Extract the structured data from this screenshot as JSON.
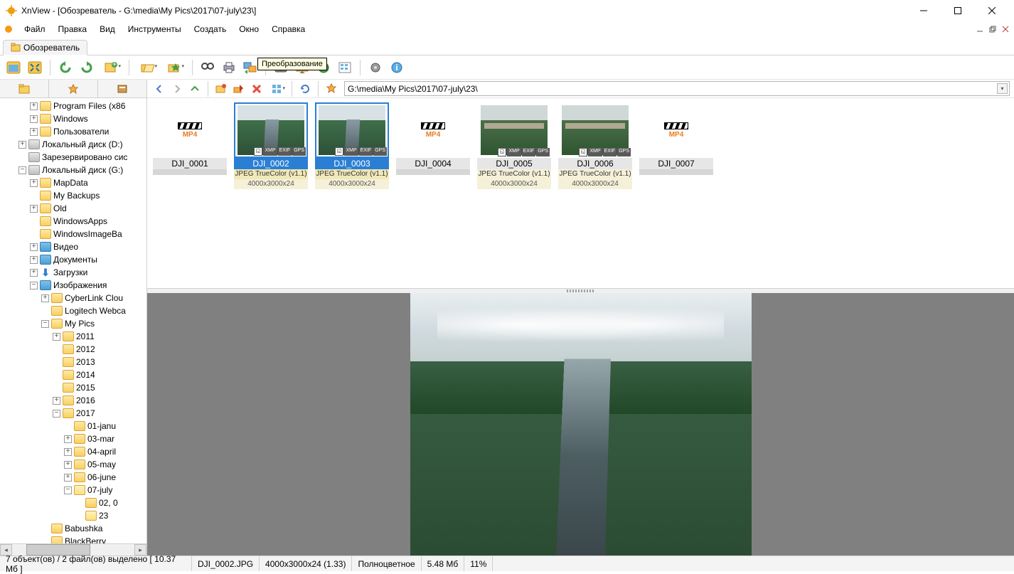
{
  "window": {
    "title": "XnView - [Обозреватель - G:\\media\\My Pics\\2017\\07-july\\23\\]"
  },
  "menu": {
    "file": "Файл",
    "edit": "Правка",
    "view": "Вид",
    "tools": "Инструменты",
    "create": "Создать",
    "window": "Окно",
    "help": "Справка"
  },
  "tab": {
    "label": "Обозреватель"
  },
  "tooltip": {
    "convert": "Преобразование"
  },
  "path": {
    "value": "G:\\media\\My Pics\\2017\\07-july\\23\\"
  },
  "tree": [
    {
      "indent": 42,
      "toggle": "+",
      "icon": "folder",
      "label": "Program Files (x86"
    },
    {
      "indent": 42,
      "toggle": "+",
      "icon": "folder",
      "label": "Windows"
    },
    {
      "indent": 42,
      "toggle": "+",
      "icon": "folder",
      "label": "Пользователи"
    },
    {
      "indent": 26,
      "toggle": "+",
      "icon": "drive",
      "label": "Локальный диск (D:)"
    },
    {
      "indent": 26,
      "toggle": "",
      "icon": "drive",
      "label": "Зарезервировано сис"
    },
    {
      "indent": 26,
      "toggle": "−",
      "icon": "drive",
      "label": "Локальный диск (G:)"
    },
    {
      "indent": 42,
      "toggle": "+",
      "icon": "folder",
      "label": "MapData"
    },
    {
      "indent": 42,
      "toggle": "",
      "icon": "folder",
      "label": "My Backups"
    },
    {
      "indent": 42,
      "toggle": "+",
      "icon": "folder",
      "label": "Old"
    },
    {
      "indent": 42,
      "toggle": "",
      "icon": "folder",
      "label": "WindowsApps"
    },
    {
      "indent": 42,
      "toggle": "",
      "icon": "folder",
      "label": "WindowsImageBa"
    },
    {
      "indent": 42,
      "toggle": "+",
      "icon": "pic",
      "label": "Видео"
    },
    {
      "indent": 42,
      "toggle": "+",
      "icon": "pic",
      "label": "Документы"
    },
    {
      "indent": 42,
      "toggle": "+",
      "icon": "down",
      "label": "Загрузки"
    },
    {
      "indent": 42,
      "toggle": "−",
      "icon": "pic",
      "label": "Изображения"
    },
    {
      "indent": 58,
      "toggle": "+",
      "icon": "folder",
      "label": "CyberLink Clou"
    },
    {
      "indent": 58,
      "toggle": "",
      "icon": "folder",
      "label": "Logitech Webca"
    },
    {
      "indent": 58,
      "toggle": "−",
      "icon": "folder",
      "label": "My Pics"
    },
    {
      "indent": 74,
      "toggle": "+",
      "icon": "folder",
      "label": "2011"
    },
    {
      "indent": 74,
      "toggle": "",
      "icon": "folder",
      "label": "2012"
    },
    {
      "indent": 74,
      "toggle": "",
      "icon": "folder",
      "label": "2013"
    },
    {
      "indent": 74,
      "toggle": "",
      "icon": "folder",
      "label": "2014"
    },
    {
      "indent": 74,
      "toggle": "",
      "icon": "folder",
      "label": "2015"
    },
    {
      "indent": 74,
      "toggle": "+",
      "icon": "folder",
      "label": "2016"
    },
    {
      "indent": 74,
      "toggle": "−",
      "icon": "folder",
      "label": "2017"
    },
    {
      "indent": 90,
      "toggle": "",
      "icon": "folder",
      "label": "01-janu"
    },
    {
      "indent": 90,
      "toggle": "+",
      "icon": "folder",
      "label": "03-mar"
    },
    {
      "indent": 90,
      "toggle": "+",
      "icon": "folder",
      "label": "04-april"
    },
    {
      "indent": 90,
      "toggle": "+",
      "icon": "folder",
      "label": "05-may"
    },
    {
      "indent": 90,
      "toggle": "+",
      "icon": "folder",
      "label": "06-june"
    },
    {
      "indent": 90,
      "toggle": "−",
      "icon": "folderopen",
      "label": "07-july"
    },
    {
      "indent": 106,
      "toggle": "",
      "icon": "folder",
      "label": "02, 0"
    },
    {
      "indent": 106,
      "toggle": "",
      "icon": "folderopen",
      "label": "23"
    },
    {
      "indent": 58,
      "toggle": "",
      "icon": "folder",
      "label": "Babushka"
    },
    {
      "indent": 58,
      "toggle": "",
      "icon": "folder",
      "label": "BlackBerry"
    }
  ],
  "thumbs": [
    {
      "type": "video",
      "name": "DJI_0001",
      "selected": false
    },
    {
      "type": "jpeg",
      "name": "DJI_0002",
      "meta": "JPEG TrueColor (v1.1)",
      "dim": "4000x3000x24",
      "selected": true,
      "look": "aerial"
    },
    {
      "type": "jpeg",
      "name": "DJI_0003",
      "meta": "JPEG TrueColor (v1.1)",
      "dim": "4000x3000x24",
      "selected": true,
      "look": "aerial"
    },
    {
      "type": "video",
      "name": "DJI_0004",
      "selected": false
    },
    {
      "type": "jpeg",
      "name": "DJI_0005",
      "meta": "JPEG TrueColor (v1.1)",
      "dim": "4000x3000x24",
      "selected": false,
      "look": "aerial2"
    },
    {
      "type": "jpeg",
      "name": "DJI_0006",
      "meta": "JPEG TrueColor (v1.1)",
      "dim": "4000x3000x24",
      "selected": false,
      "look": "aerial2"
    },
    {
      "type": "video",
      "name": "DJI_0007",
      "selected": false
    }
  ],
  "badges": {
    "xmp": "XMP",
    "exif": "EXIF",
    "gps": "GPS"
  },
  "status": {
    "selection": "7 объект(ов) / 2 файл(ов) выделено  [ 10.37 Мб ]",
    "filename": "DJI_0002.JPG",
    "dimensions": "4000x3000x24 (1.33)",
    "colormode": "Полноцветное",
    "filesize": "5.48 Мб",
    "zoom": "11%"
  }
}
